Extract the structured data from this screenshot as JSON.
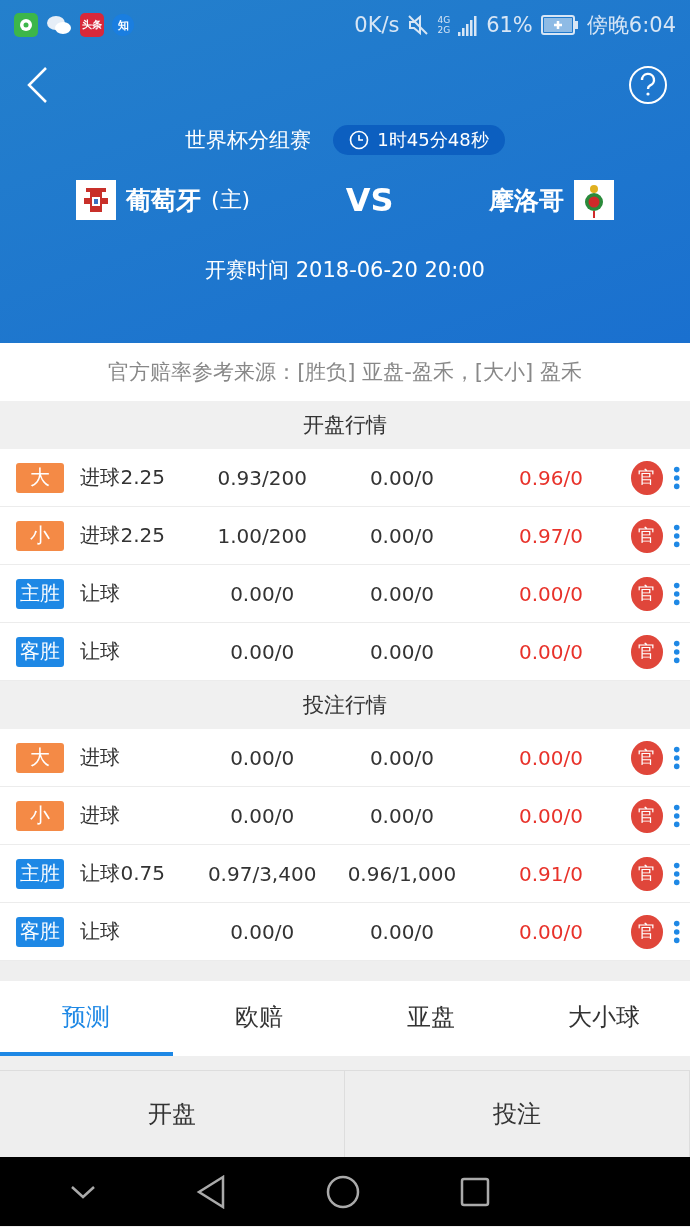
{
  "status_bar": {
    "app_icons": [
      {
        "kind": "soccer"
      },
      {
        "kind": "chat"
      },
      {
        "kind": "news",
        "label": "头条"
      },
      {
        "kind": "zhi",
        "label": "知"
      }
    ],
    "speed": "0K/s",
    "network": [
      "4G",
      "2G"
    ],
    "battery": "61%",
    "time": "傍晚6:04"
  },
  "header": {
    "competition": "世界杯分组赛",
    "countdown": "1时45分48秒",
    "home_team": "葡萄牙",
    "home_mark": "(主)",
    "vs": "VS",
    "away_team": "摩洛哥",
    "kickoff": "开赛时间 2018-06-20 20:00"
  },
  "source_note": "官方赔率参考来源：[胜负] 亚盘-盈禾，[大小] 盈禾",
  "sections": [
    {
      "title": "开盘行情",
      "rows": [
        {
          "tag": "大",
          "color": "#f48a46",
          "label": "进球2.25",
          "col1": "0.93/200",
          "col2": "0.00/0",
          "col3": "0.96/0",
          "badge": "官"
        },
        {
          "tag": "小",
          "color": "#f48a46",
          "label": "进球2.25",
          "col1": "1.00/200",
          "col2": "0.00/0",
          "col3": "0.97/0",
          "badge": "官"
        },
        {
          "tag": "主胜",
          "color": "#1e88e5",
          "label": "让球",
          "col1": "0.00/0",
          "col2": "0.00/0",
          "col3": "0.00/0",
          "badge": "官"
        },
        {
          "tag": "客胜",
          "color": "#1e88e5",
          "label": "让球",
          "col1": "0.00/0",
          "col2": "0.00/0",
          "col3": "0.00/0",
          "badge": "官"
        }
      ]
    },
    {
      "title": "投注行情",
      "rows": [
        {
          "tag": "大",
          "color": "#f48a46",
          "label": "进球",
          "col1": "0.00/0",
          "col2": "0.00/0",
          "col3": "0.00/0",
          "badge": "官"
        },
        {
          "tag": "小",
          "color": "#f48a46",
          "label": "进球",
          "col1": "0.00/0",
          "col2": "0.00/0",
          "col3": "0.00/0",
          "badge": "官"
        },
        {
          "tag": "主胜",
          "color": "#1e88e5",
          "label": "让球0.75",
          "col1": "0.97/3,400",
          "col2": "0.96/1,000",
          "col3": "0.91/0",
          "badge": "官"
        },
        {
          "tag": "客胜",
          "color": "#1e88e5",
          "label": "让球",
          "col1": "0.00/0",
          "col2": "0.00/0",
          "col3": "0.00/0",
          "badge": "官"
        }
      ]
    }
  ],
  "tabs": [
    {
      "label": "预测",
      "selected": true
    },
    {
      "label": "欧赔",
      "selected": false
    },
    {
      "label": "亚盘",
      "selected": false
    },
    {
      "label": "大小球",
      "selected": false
    }
  ],
  "bottom_buttons": [
    {
      "label": "开盘",
      "selected": false
    },
    {
      "label": "投注",
      "selected": false
    }
  ]
}
